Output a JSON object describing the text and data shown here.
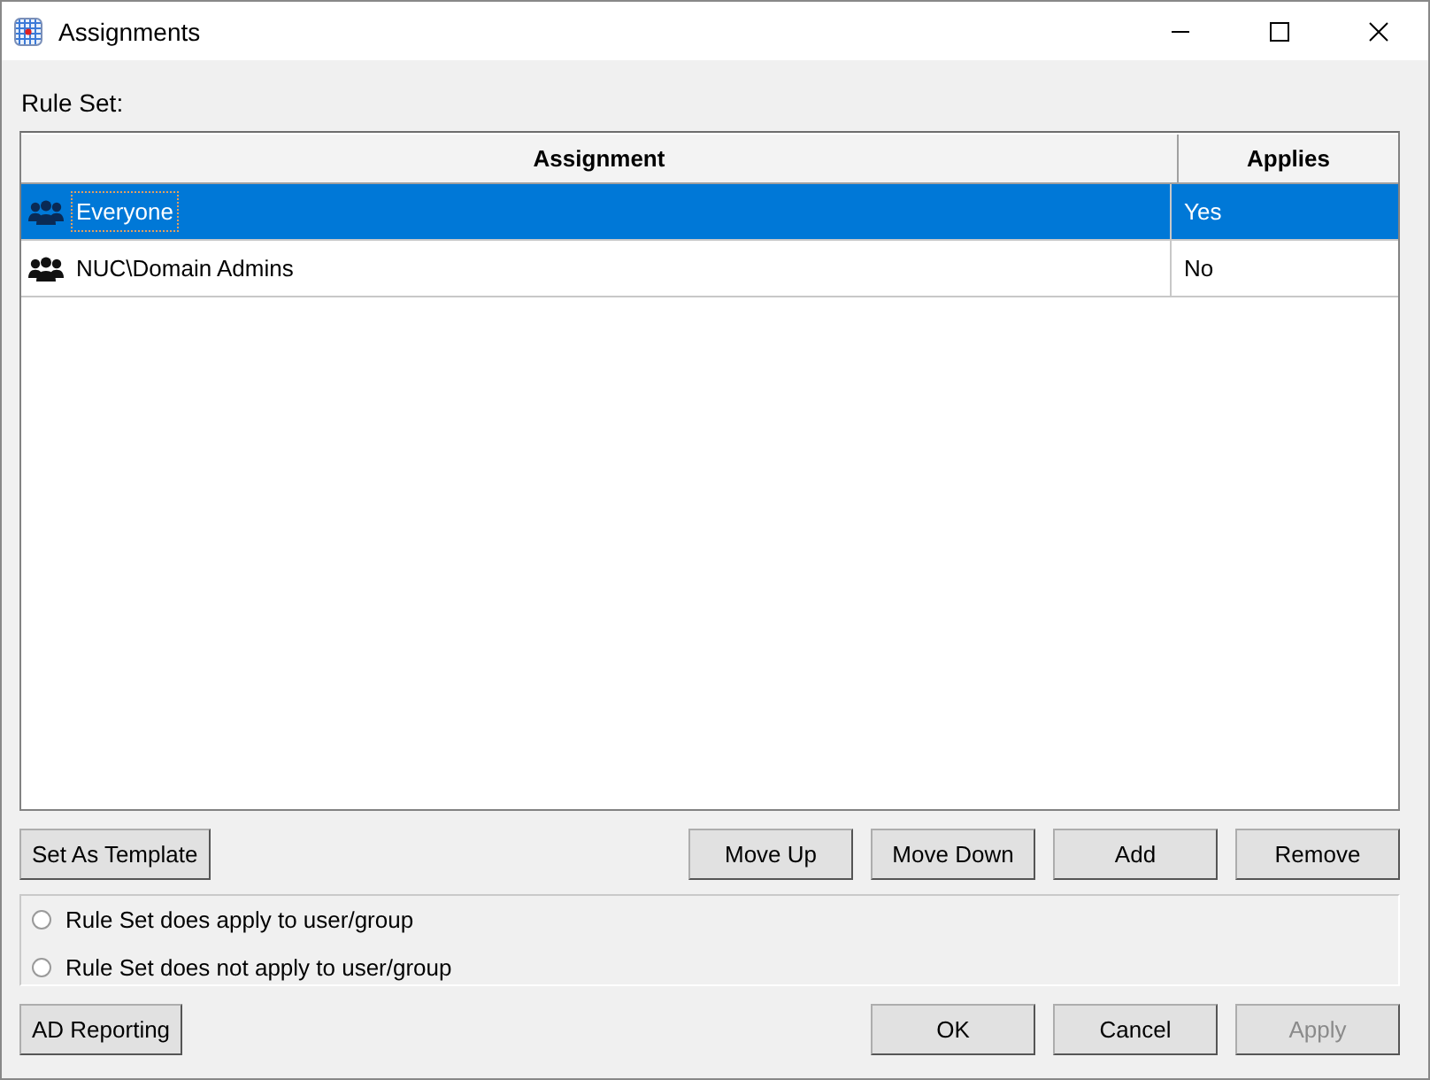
{
  "window": {
    "title": "Assignments"
  },
  "rule_set_label": "Rule Set:",
  "table": {
    "columns": [
      "Assignment",
      "Applies"
    ],
    "rows": [
      {
        "assignment": "Everyone",
        "applies": "Yes",
        "selected": true
      },
      {
        "assignment": "NUC\\Domain Admins",
        "applies": "No",
        "selected": false
      }
    ]
  },
  "left_button": "Set As Template",
  "row_buttons": [
    "Move Up",
    "Move Down",
    "Add",
    "Remove"
  ],
  "radios": [
    {
      "label": "Rule Set does apply to user/group",
      "selected": false
    },
    {
      "label": "Rule Set does not apply to user/group",
      "selected": false
    }
  ],
  "bottom_left_button": "AD Reporting",
  "bottom_buttons": [
    {
      "label": "OK",
      "disabled": false
    },
    {
      "label": "Cancel",
      "disabled": false
    },
    {
      "label": "Apply",
      "disabled": true
    }
  ]
}
